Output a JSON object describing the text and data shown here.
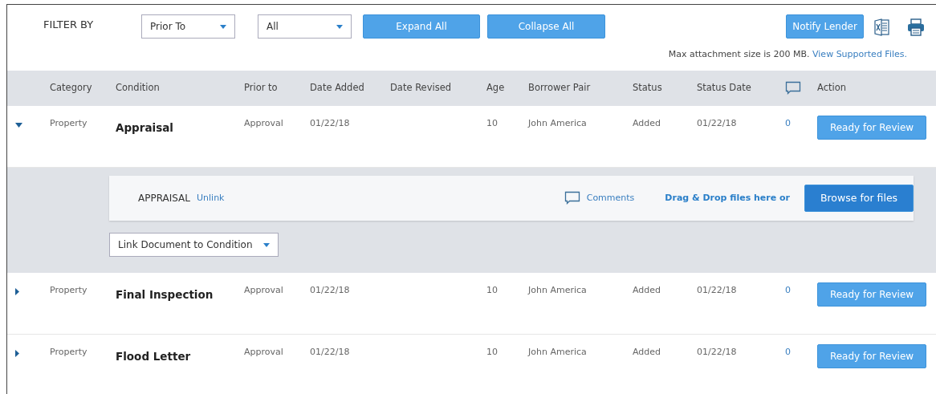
{
  "toolbar": {
    "filter_label": "FILTER BY",
    "filters": [
      {
        "value": "Prior To"
      },
      {
        "value": "All"
      }
    ],
    "buttons": [
      "Expand All",
      "Collapse All"
    ],
    "notify_button": "Notify Lender"
  },
  "notice": {
    "text": "Max attachment size is 200 MB.",
    "link": "View Supported Files."
  },
  "table": {
    "columns": [
      {
        "label": "Category",
        "kind": "text"
      },
      {
        "label": "Condition",
        "kind": "text"
      },
      {
        "label": "Prior to",
        "kind": "text"
      },
      {
        "label": "Date Added",
        "kind": "text"
      },
      {
        "label": "Date Revised",
        "kind": "text"
      },
      {
        "label": "Age",
        "kind": "text"
      },
      {
        "label": "Borrower Pair",
        "kind": "text"
      },
      {
        "label": "Status",
        "kind": "text"
      },
      {
        "label": "Status Date",
        "kind": "text"
      },
      {
        "kind": "comment-icon"
      },
      {
        "label": "Action",
        "kind": "text"
      }
    ],
    "rows": [
      {
        "expanded": true,
        "category": "Property",
        "condition": "Appraisal",
        "prior_to": "Approval",
        "date_added": "01/22/18",
        "age": "10",
        "borrower_pair": "John America",
        "status": "Added",
        "status_date": "01/22/18",
        "comments": "0",
        "action": "Ready for Review",
        "detail": {
          "name": "APPRAISAL",
          "unlink": "Unlink",
          "comments": "Comments",
          "drop_text": "Drag & Drop files here or",
          "browse_button": "Browse for files",
          "link_select": "Link Document to Condition"
        }
      },
      {
        "expanded": false,
        "category": "Property",
        "condition": "Final Inspection",
        "prior_to": "Approval",
        "date_added": "01/22/18",
        "age": "10",
        "borrower_pair": "John America",
        "status": "Added",
        "status_date": "01/22/18",
        "comments": "0",
        "action": "Ready for Review"
      },
      {
        "expanded": false,
        "category": "Property",
        "condition": "Flood Letter",
        "prior_to": "Approval",
        "date_added": "01/22/18",
        "age": "10",
        "borrower_pair": "John America",
        "status": "Added",
        "status_date": "01/22/18",
        "comments": "0",
        "action": "Ready for Review"
      }
    ]
  }
}
